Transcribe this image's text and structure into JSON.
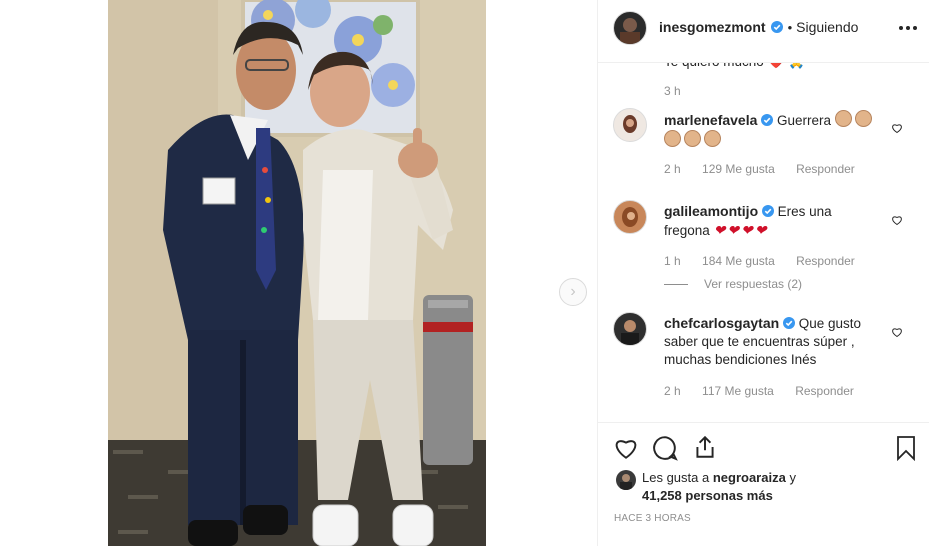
{
  "post": {
    "username": "inesgomezmont",
    "follow_status": "Siguiendo",
    "separator": "•",
    "more_icon": "more-horizontal-icon"
  },
  "comments": {
    "partial_text": "Te quiero mucho ❤️ 🙏",
    "partial_time": "3 h",
    "items": [
      {
        "username": "marlenefavela",
        "verified": true,
        "text": "Guerrera",
        "emoji": [
          "clap",
          "clap",
          "clap",
          "clap",
          "clap"
        ],
        "time": "2 h",
        "likes": "129 Me gusta",
        "reply": "Responder"
      },
      {
        "username": "galileamontijo",
        "verified": true,
        "text": "Eres una fregona",
        "emoji": [
          "heart",
          "heart",
          "heart",
          "heart"
        ],
        "time": "1 h",
        "likes": "184 Me gusta",
        "reply": "Responder",
        "view_replies": "Ver respuestas (2)"
      },
      {
        "username": "chefcarlosgaytan",
        "verified": true,
        "text": "Que gusto saber que te encuentras súper , muchas bendiciones Inés",
        "time": "2 h",
        "likes": "117 Me gusta",
        "reply": "Responder"
      }
    ]
  },
  "actions": {
    "liked_by_prefix": "Les gusta a",
    "liked_by_user": "negroaraiza",
    "liked_by_and": "y",
    "liked_by_count": "41,258 personas más",
    "time_ago": "HACE 3 HORAS"
  },
  "colors": {
    "verified_blue": "#3897f0",
    "text": "#262626",
    "muted": "#8e8e8e",
    "border": "#efefef"
  }
}
